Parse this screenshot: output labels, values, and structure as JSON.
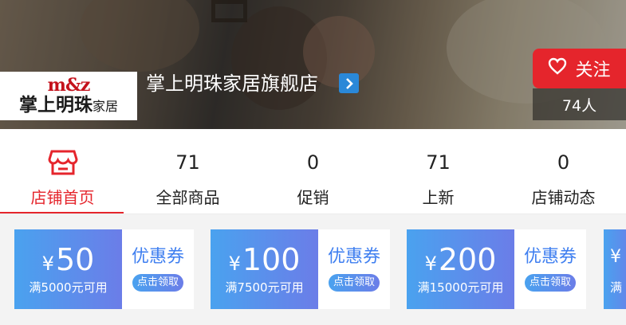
{
  "header": {
    "logo_mark": "m&z",
    "logo_main": "掌上明珠",
    "logo_sub": "家居",
    "shop_name": "掌上明珠家居旗舰店",
    "arrow_icon": "chevron-right-icon",
    "follow_icon": "heart-outline-icon",
    "follow_label": "关注",
    "follower_count": "74人"
  },
  "tabs": [
    {
      "label": "店铺首页",
      "icon": "storefront-icon",
      "active": true
    },
    {
      "label": "全部商品",
      "count": "71"
    },
    {
      "label": "促销",
      "count": "0"
    },
    {
      "label": "上新",
      "count": "71"
    },
    {
      "label": "店铺动态",
      "count": "0"
    }
  ],
  "coupons": [
    {
      "currency": "¥",
      "amount": "50",
      "condition": "满5000元可用",
      "title": "优惠券",
      "button": "点击领取"
    },
    {
      "currency": "¥",
      "amount": "100",
      "condition": "满7500元可用",
      "title": "优惠券",
      "button": "点击领取"
    },
    {
      "currency": "¥",
      "amount": "200",
      "condition": "满15000元可用",
      "title": "优惠券",
      "button": "点击领取"
    }
  ],
  "coupon_peek": {
    "currency": "¥",
    "condition_fragment": "满"
  },
  "colors": {
    "accent_red": "#e5252c",
    "coupon_blue_start": "#4aa2ef",
    "coupon_blue_end": "#6b7de8",
    "coupon_title_blue": "#3f7ff0",
    "shop_arrow_blue": "#2a88d8"
  }
}
